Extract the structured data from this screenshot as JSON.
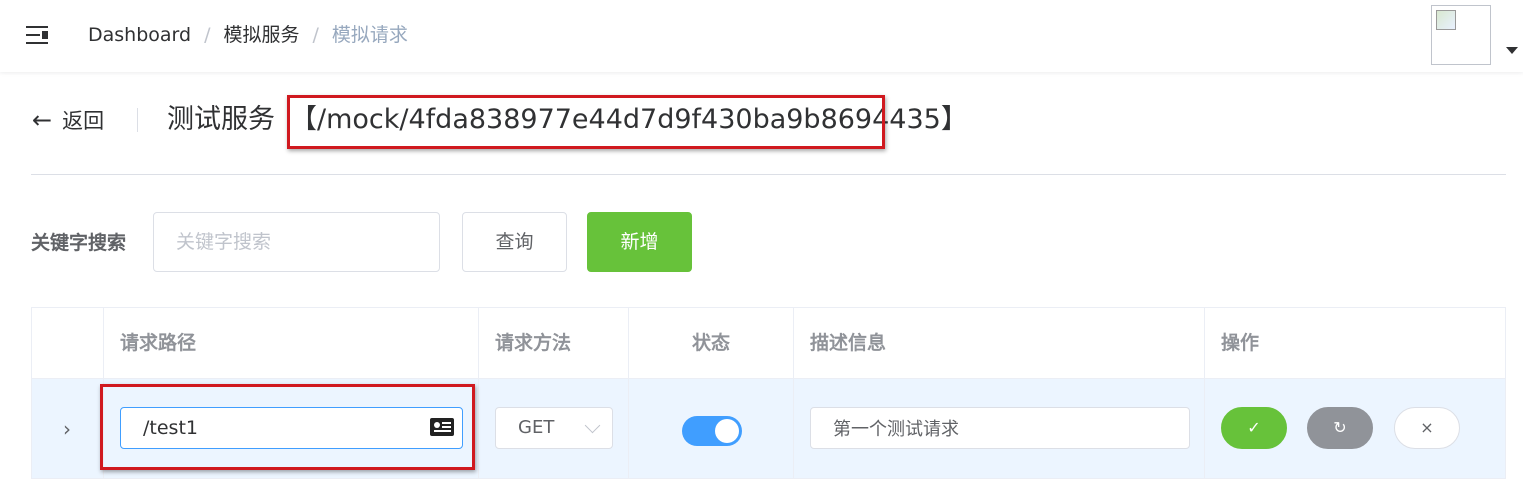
{
  "navbar": {
    "breadcrumb": [
      "Dashboard",
      "模拟服务",
      "模拟请求"
    ],
    "separator": "/"
  },
  "header": {
    "back_label": "返回",
    "title": "测试服务",
    "mock_path": "【/mock/4fda838977e44d7d9f430ba9b8694435】"
  },
  "search": {
    "label": "关键字搜索",
    "placeholder": "关键字搜索",
    "value": "",
    "query_button": "查询",
    "add_button": "新增"
  },
  "table": {
    "columns": [
      "请求路径",
      "请求方法",
      "状态",
      "描述信息",
      "操作"
    ],
    "rows": [
      {
        "expand_icon": "›",
        "path": "/test1",
        "method": "GET",
        "enabled": true,
        "description": "第一个测试请求",
        "actions": {
          "confirm": "✓",
          "reset": "↻",
          "cancel": "×"
        }
      }
    ]
  },
  "colors": {
    "primary": "#409eff",
    "success": "#67c23a",
    "info": "#909399",
    "highlight": "#d0191f",
    "row_highlight": "#ecf5ff"
  },
  "icons": [
    "hamburger-icon",
    "back-arrow-icon",
    "expand-icon",
    "contact-card-icon",
    "chevron-down-icon",
    "check-icon",
    "refresh-icon",
    "close-icon",
    "avatar-broken-image-icon",
    "caret-down-icon"
  ]
}
